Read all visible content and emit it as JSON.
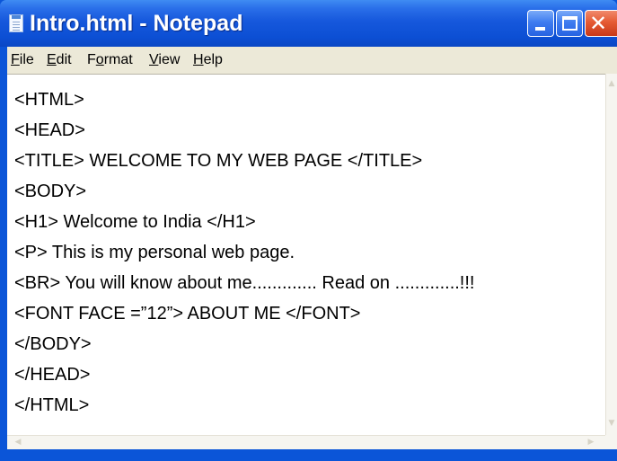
{
  "window": {
    "title": "Intro.html - Notepad",
    "icon": "notepad-icon",
    "colors": {
      "titlebar": "#1658dc",
      "close_button": "#e55a33",
      "menubar": "#ece9d8",
      "editor_background": "#ffffff"
    },
    "controls": {
      "minimize_icon": "minimize-icon",
      "maximize_icon": "maximize-icon",
      "close_icon": "close-icon",
      "close_glyph": "✕"
    }
  },
  "menu": {
    "items": [
      {
        "label": "File",
        "accel": "F"
      },
      {
        "label": "Edit",
        "accel": "E"
      },
      {
        "label": "Format",
        "accel": "o"
      },
      {
        "label": "View",
        "accel": "V"
      },
      {
        "label": "Help",
        "accel": "H"
      }
    ]
  },
  "editor": {
    "lines": [
      "<HTML>",
      "<HEAD>",
      "<TITLE> WELCOME TO MY WEB PAGE </TITLE>",
      "<BODY>",
      "<H1> Welcome to India </H1>",
      "<P> This is my personal web page.",
      "<BR> You will know about me............. Read on .............!!!",
      "<FONT FACE =”12”> ABOUT ME </FONT>",
      "</BODY>",
      "</HEAD>",
      "</HTML>"
    ]
  },
  "scrollbars": {
    "up_glyph": "▲",
    "down_glyph": "▼",
    "left_glyph": "◀",
    "right_glyph": "▶"
  }
}
